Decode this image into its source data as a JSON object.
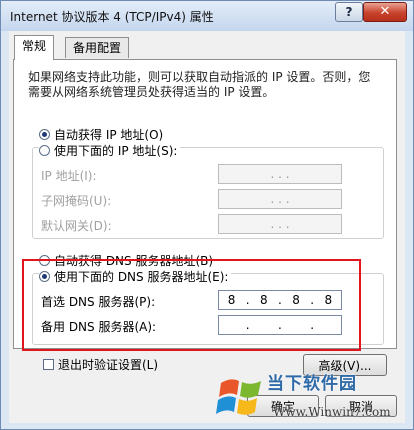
{
  "window": {
    "title": "Internet 协议版本 4 (TCP/IPv4) 属性",
    "help_label": "?",
    "close_label": "✕"
  },
  "tabs": [
    {
      "label": "常规",
      "active": true
    },
    {
      "label": "备用配置",
      "active": false
    }
  ],
  "description": "如果网络支持此功能，则可以获取自动指派的 IP 设置。否则，您需要从网络系统管理员处获得适当的 IP 设置。",
  "ip_section": {
    "auto_option": "自动获得 IP 地址(O)",
    "manual_option": "使用下面的 IP 地址(S):",
    "fields": [
      {
        "label": "IP 地址(I):",
        "value": ". . ."
      },
      {
        "label": "子网掩码(U):",
        "value": ". . ."
      },
      {
        "label": "默认网关(D):",
        "value": ". . ."
      }
    ]
  },
  "dns_section": {
    "auto_option": "自动获得 DNS 服务器地址(B)",
    "manual_option": "使用下面的 DNS 服务器地址(E):",
    "preferred": {
      "label": "首选 DNS 服务器(P):",
      "octets": [
        "8",
        "8",
        "8",
        "8"
      ]
    },
    "alternate": {
      "label": "备用 DNS 服务器(A):",
      "octets": [
        "",
        "",
        "",
        ""
      ]
    }
  },
  "validate_checkbox": "退出时验证设置(L)",
  "advanced_button": "高级(V)...",
  "ok_button": "确定",
  "cancel_button": "取消",
  "watermark": {
    "line1": "当下软件园",
    "line2": "Www.Winwin7.com"
  },
  "colors": {
    "highlight": "#e0161c",
    "close": "#c8412b"
  }
}
